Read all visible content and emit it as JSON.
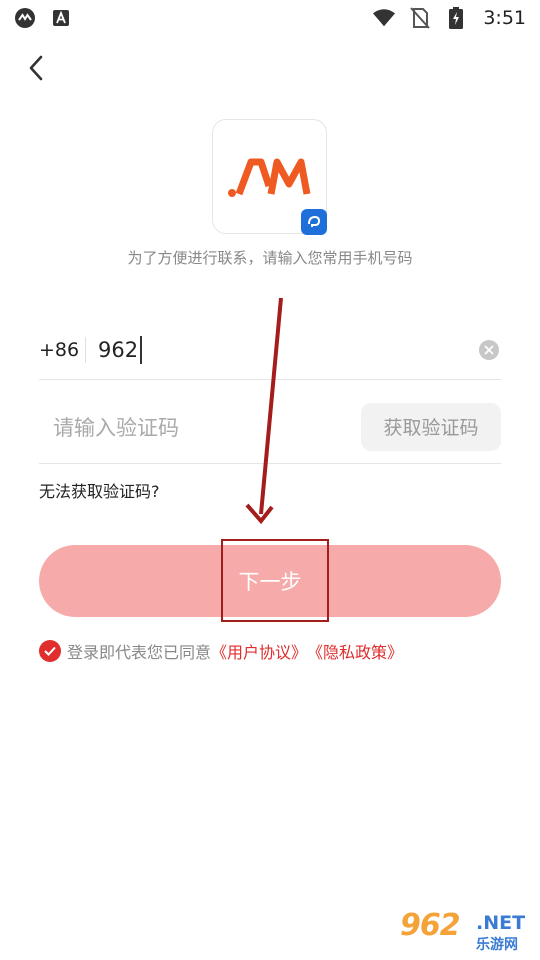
{
  "status_bar": {
    "time": "3:51",
    "left_icons": [
      "app-notification-icon",
      "font-a-icon"
    ],
    "right_icons": [
      "wifi-icon",
      "no-sim-icon",
      "battery-charging-icon"
    ]
  },
  "header": {
    "back_icon": "chevron-left-icon"
  },
  "logo": {
    "text": "AM"
  },
  "subtitle": "为了方便进行联系，请输入您常用手机号码",
  "phone": {
    "country_code": "+86",
    "value": "962"
  },
  "code": {
    "placeholder": "请输入验证码",
    "get_code_label": "获取验证码"
  },
  "cannot_get_label": "无法获取验证码?",
  "next_label": "下一步",
  "agreement": {
    "prefix": "登录即代表您已同意",
    "user_agreement": "《用户协议》",
    "privacy_policy": "《隐私政策》"
  },
  "watermark": {
    "number": "962",
    "net": ".NET",
    "site": "乐游网"
  },
  "colors": {
    "accent": "#e02d2d",
    "button_disabled": "#f7aaaa",
    "annotation": "#a51c1c"
  }
}
